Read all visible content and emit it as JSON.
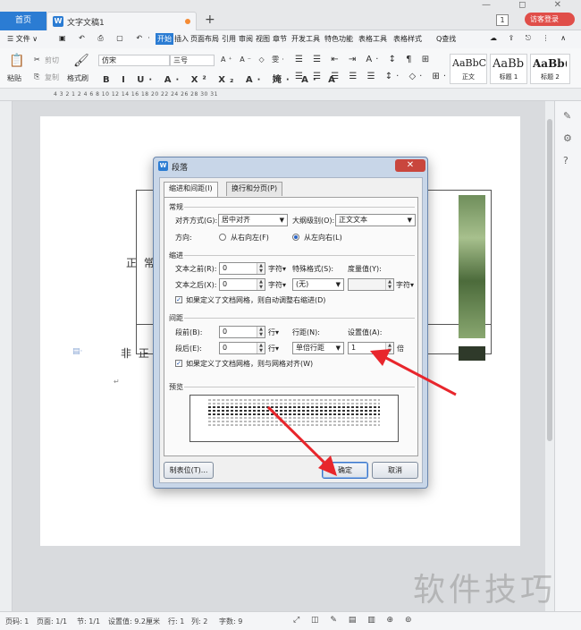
{
  "titlebar": {
    "home_tab": "首页",
    "doc_tab": "文字文稿1",
    "new_tab": "+",
    "badge": "1",
    "visitor_label": "访客登录",
    "window_controls": "—  ◻  ✕"
  },
  "menu": {
    "file": "☰ 文件 ∨",
    "items": [
      "开始",
      "插入",
      "页面布局",
      "引用",
      "审阅",
      "视图",
      "章节",
      "开发工具",
      "特色功能",
      "表格工具",
      "表格样式"
    ],
    "search": "Q查找"
  },
  "ribbon": {
    "paste": "粘贴",
    "cut": "剪切",
    "copy": "复制",
    "format_painter": "格式刷",
    "font_name": "仿宋",
    "font_size": "三号",
    "styles": [
      {
        "sample": "AaBbCcI",
        "name": "正文"
      },
      {
        "sample": "AaBb",
        "name": "标题 1"
      },
      {
        "sample": "AaBb(",
        "name": "标题 2"
      }
    ]
  },
  "ruler": {
    "numbers": "4   3   2   1        2   4   6   8   10  12  14  16  18  20  22  24  26  28  30  31"
  },
  "document": {
    "cell_1": "正 常",
    "cell_2": "非 正 常"
  },
  "dialog": {
    "title": "段落",
    "close": "✕",
    "tabs": [
      "缩进和间距(I)",
      "换行和分页(P)"
    ],
    "general": {
      "heading": "常规",
      "alignment_label": "对齐方式(G):",
      "alignment_value": "居中对齐",
      "outline_label": "大纲级别(O):",
      "outline_value": "正文文本",
      "direction_label": "方向:",
      "ltr_label": "从右向左(F)",
      "rtl_label": "从左向右(L)"
    },
    "indent": {
      "heading": "缩进",
      "before_label": "文本之前(R):",
      "before_value": "0",
      "before_unit": "字符▾",
      "after_label": "文本之后(X):",
      "after_value": "0",
      "after_unit": "字符▾",
      "special_label": "特殊格式(S):",
      "special_value": "(无)",
      "measure_label": "度量值(Y):",
      "measure_unit": "字符▾",
      "grid_check": "如果定义了文档网格，则自动调整右缩进(D)"
    },
    "spacing": {
      "heading": "间距",
      "before_label": "段前(B):",
      "before_value": "0",
      "before_unit": "行▾",
      "after_label": "段后(E):",
      "after_value": "0",
      "after_unit": "行▾",
      "line_label": "行距(N):",
      "line_value": "单倍行距",
      "setting_label": "设置值(A):",
      "setting_value": "1",
      "setting_unit": "倍",
      "grid_check": "如果定义了文档网格，则与网格对齐(W)"
    },
    "preview_heading": "预览",
    "tabs_button": "制表位(T)...",
    "ok_button": "确定",
    "cancel_button": "取消"
  },
  "statusbar": {
    "page": "页码: 1",
    "pages": "页面: 1/1",
    "section": "节: 1/1",
    "setting": "设置值: 9.2厘米",
    "row": "行: 1",
    "col": "列: 2",
    "words": "字数: 9"
  },
  "watermark": "软件技巧",
  "colors": {
    "accent": "#2b7cd3",
    "arrow": "#e8262c",
    "visitor": "#e04e49"
  }
}
